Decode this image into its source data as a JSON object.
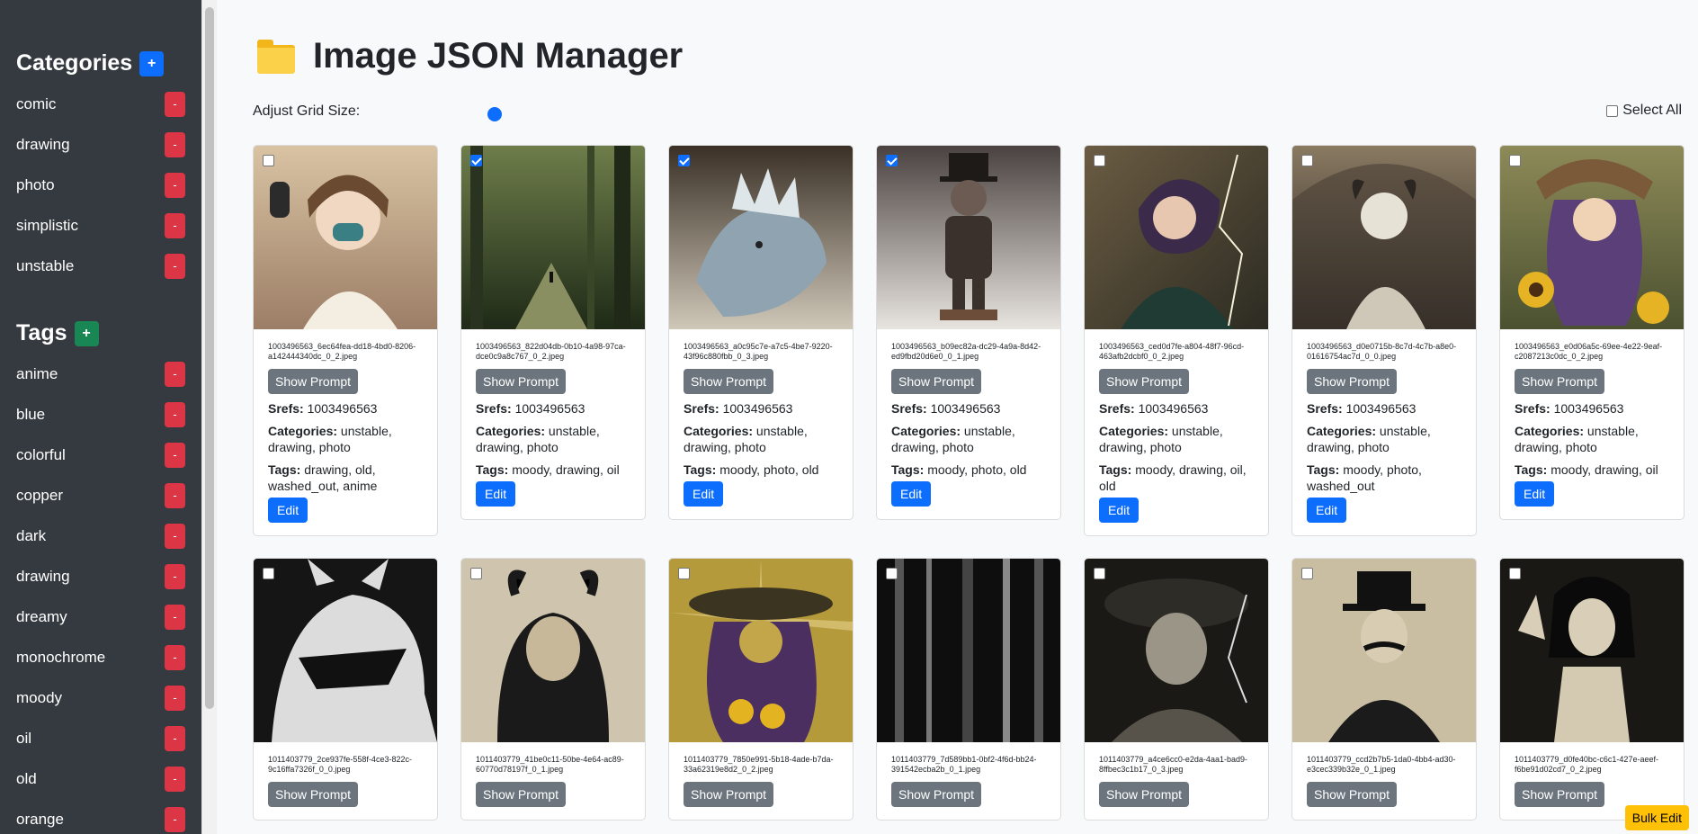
{
  "sidebar": {
    "categories_heading": "Categories",
    "add_category_label": "+",
    "categories": [
      "comic",
      "drawing",
      "photo",
      "simplistic",
      "unstable"
    ],
    "tags_heading": "Tags",
    "add_tag_label": "+",
    "tags": [
      "anime",
      "blue",
      "colorful",
      "copper",
      "dark",
      "drawing",
      "dreamy",
      "monochrome",
      "moody",
      "oil",
      "old",
      "orange"
    ],
    "remove_label": "-"
  },
  "header": {
    "title": "Image JSON Manager",
    "icon": "folder-icon",
    "grid_size_label": "Adjust Grid Size:",
    "select_all_label": "Select All"
  },
  "labels": {
    "show_prompt": "Show Prompt",
    "edit": "Edit",
    "srefs": "Srefs:",
    "categories": "Categories:",
    "tags": "Tags:",
    "bulk_edit": "Bulk Edit"
  },
  "cards_row1": [
    {
      "filename": "1003496563_6ec64fea-dd18-4bd0-8206-a142444340dc_0_2.jpeg",
      "srefs": "1003496563",
      "categories": "unstable, drawing, photo",
      "tags": "drawing, old, washed_out, anime",
      "checked": false
    },
    {
      "filename": "1003496563_822d04db-0b10-4a98-97ca-dce0c9a8c767_0_2.jpeg",
      "srefs": "1003496563",
      "categories": "unstable, drawing, photo",
      "tags": "moody, drawing, oil",
      "checked": true
    },
    {
      "filename": "1003496563_a0c95c7e-a7c5-4be7-9220-43f96c880fbb_0_3.jpeg",
      "srefs": "1003496563",
      "categories": "unstable, drawing, photo",
      "tags": "moody, photo, old",
      "checked": true
    },
    {
      "filename": "1003496563_b09ec82a-dc29-4a9a-8d42-ed9fbd20d6e0_0_1.jpeg",
      "srefs": "1003496563",
      "categories": "unstable, drawing, photo",
      "tags": "moody, photo, old",
      "checked": true
    },
    {
      "filename": "1003496563_ced0d7fe-a804-48f7-96cd-463afb2dcbf0_0_2.jpeg",
      "srefs": "1003496563",
      "categories": "unstable, drawing, photo",
      "tags": "moody, drawing, oil, old",
      "checked": false
    },
    {
      "filename": "1003496563_d0e0715b-8c7d-4c7b-a8e0-01616754ac7d_0_0.jpeg",
      "srefs": "1003496563",
      "categories": "unstable, drawing, photo",
      "tags": "moody, photo, washed_out",
      "checked": false
    },
    {
      "filename": "1003496563_e0d06a5c-69ee-4e22-9eaf-c2087213c0dc_0_2.jpeg",
      "srefs": "1003496563",
      "categories": "unstable, drawing, photo",
      "tags": "moody, drawing, oil",
      "checked": false
    }
  ],
  "cards_row2": [
    {
      "filename": "1011403779_2ce937fe-558f-4ce3-822c-9c16ffa7326f_0_0.jpeg",
      "checked": false
    },
    {
      "filename": "1011403779_41be0c11-50be-4e64-ac89-60770d78197f_0_1.jpeg",
      "checked": false
    },
    {
      "filename": "1011403779_7850e991-5b18-4ade-b7da-33a62319e8d2_0_2.jpeg",
      "checked": false
    },
    {
      "filename": "1011403779_7d589bb1-0bf2-4f6d-bb24-391542ecba2b_0_1.jpeg",
      "checked": false
    },
    {
      "filename": "1011403779_a4ce6cc0-e2da-4aa1-bad9-8ffbec3c1b17_0_3.jpeg",
      "checked": false
    },
    {
      "filename": "1011403779_ccd2b7b5-1da0-4bb4-ad30-e3cec339b32e_0_1.jpeg",
      "checked": false
    },
    {
      "filename": "1011403779_d0fe40bc-c6c1-427e-aeef-f6be91d02cd7_0_2.jpeg",
      "checked": false
    }
  ]
}
